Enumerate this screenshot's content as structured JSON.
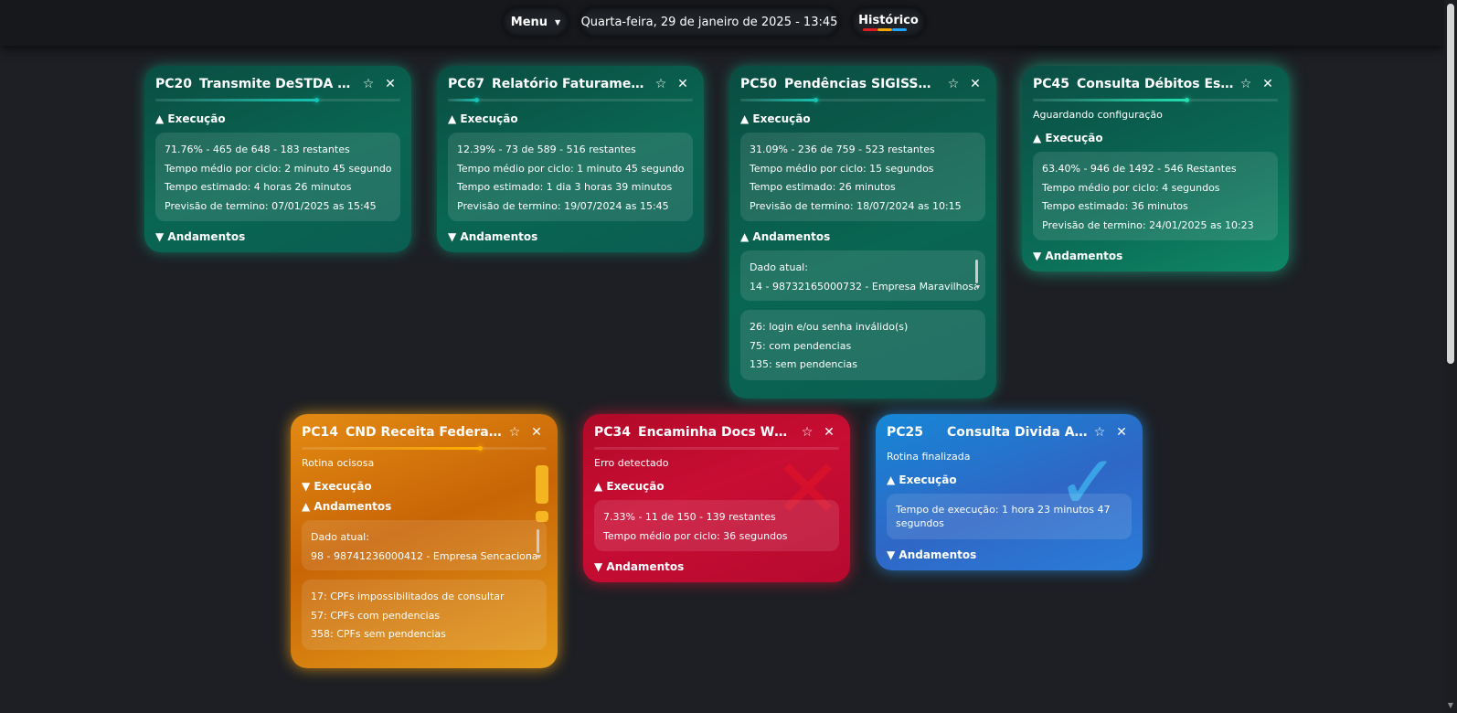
{
  "topbar": {
    "menu_label": "Menu",
    "date_label": "Quarta-feira, 29 de janeiro de 2025 - 13:45",
    "history_label": "Histórico",
    "history_underline_colors": [
      "#e01b24",
      "#f6a400",
      "#1ea7ff"
    ]
  },
  "cards": [
    {
      "code": "PC20",
      "title": "Transmite DeSTDA semanal",
      "progress": 0.66,
      "accent": "#17c3b2",
      "exec_toggle": "▲ Execução",
      "exec_lines": [
        "71.76% - 465 de 648 - 183 restantes",
        "Tempo médio por ciclo: 2 minuto 45 segundos",
        "Tempo estimado: 4 horas 26 minutos",
        "Previsão de termino: 07/01/2025 as 15:45"
      ],
      "and_toggle": "▼ Andamentos"
    },
    {
      "code": "PC67",
      "title": "Relatório Faturamento Mensal",
      "progress": 0.12,
      "accent": "#17c3b2",
      "exec_toggle": "▲ Execução",
      "exec_lines": [
        "12.39% - 73 de 589 - 516 restantes",
        "Tempo médio por ciclo: 1 minuto 45 segundos",
        "Tempo estimado: 1 dia 3 horas 39 minutos",
        "Previsão de termino: 19/07/2024 as 15:45"
      ],
      "and_toggle": "▼ Andamentos"
    },
    {
      "code": "PC50",
      "title": "Pendências SIGISSWEB",
      "progress": 0.31,
      "accent": "#17c3b2",
      "exec_toggle": "▲ Execução",
      "exec_lines": [
        "31.09% - 236 de 759 - 523 restantes",
        "Tempo médio por ciclo: 15 segundos",
        "Tempo estimado: 26 minutos",
        "Previsão de termino: 18/07/2024 as 10:15"
      ],
      "and_toggle": "▲ Andamentos",
      "current_label": "Dado atual:",
      "current_value": "14 - 98732165000732 - Empresa Maravilhosa",
      "summary_lines": [
        "26: login e/ou senha inválido(s)",
        "75: com pendencias",
        "135: sem pendencias"
      ]
    },
    {
      "code": "PC45",
      "title": "Consulta Débitos Estaduais",
      "progress": 0.63,
      "accent": "#22e0b0",
      "status": "Aguardando configuração",
      "exec_toggle": "▲ Execução",
      "exec_lines": [
        "63.40% - 946 de 1492 - 546 Restantes",
        "Tempo médio por ciclo: 4 segundos",
        "Tempo estimado: 36 minutos",
        "Previsão de termino: 24/01/2025 as 10:23"
      ],
      "and_toggle": "▼ Andamentos"
    },
    {
      "code": "PC14",
      "title": "CND Receita Federal CPF",
      "progress": 0.73,
      "accent": "#ffb000",
      "status": "Rotina ocisosa",
      "exec_toggle": "▼ Execução",
      "and_toggle": "▲ Andamentos",
      "current_label": "Dado atual:",
      "current_value": "98 - 98741236000412 - Empresa Sencacional",
      "summary_lines": [
        "17: CPFs impossibilitados de consultar",
        "57: CPFs com pendencias",
        "358: CPFs sem pendencias"
      ]
    },
    {
      "code": "PC34",
      "title": "Encaminha Docs WhatsApp",
      "status": "Erro detectado",
      "exec_toggle": "▲ Execução",
      "exec_lines": [
        "7.33% - 11 de 150 - 139 restantes",
        "Tempo médio por ciclo: 36 segundos"
      ],
      "and_toggle": "▼ Andamentos"
    },
    {
      "code": "PC25",
      "title": "Consulta Divida Ativa",
      "status": "Rotina finalizada",
      "exec_toggle": "▲ Execução",
      "exec_lines": [
        "Tempo de execução: 1 hora 23 minutos 47 segundos"
      ],
      "and_toggle": "▼ Andamentos"
    }
  ],
  "icons": {
    "favorite": "☆",
    "close": "✕",
    "caret": "▼",
    "error_mark": "✕",
    "done_mark": "✓"
  }
}
